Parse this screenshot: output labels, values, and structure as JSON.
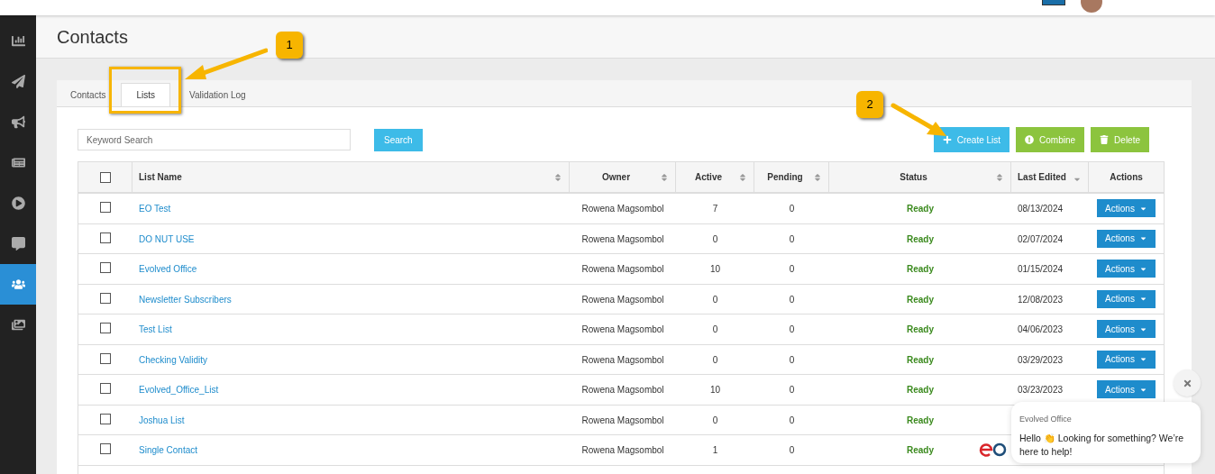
{
  "sidebar": {
    "items": [
      {
        "selected": false
      },
      {
        "selected": false
      },
      {
        "selected": false
      },
      {
        "selected": false
      },
      {
        "selected": false
      },
      {
        "selected": false
      },
      {
        "selected": true
      },
      {
        "selected": false
      }
    ]
  },
  "page_title": "Contacts",
  "tabs": [
    {
      "label": "Contacts",
      "selected": false
    },
    {
      "label": "Lists",
      "selected": true
    },
    {
      "label": "Validation Log",
      "selected": false
    }
  ],
  "search": {
    "placeholder": "Keyword Search",
    "button": "Search"
  },
  "toolbar": [
    {
      "kind": "create",
      "label": "Create List"
    },
    {
      "kind": "combine",
      "label": "Combine"
    },
    {
      "kind": "delete",
      "label": "Delete"
    }
  ],
  "table": {
    "select_all": {
      "checked": false
    },
    "columns": [
      {
        "label": "List Name"
      },
      {
        "label": "Owner"
      },
      {
        "label": "Active"
      },
      {
        "label": "Pending"
      },
      {
        "label": "Status"
      },
      {
        "label": "Last Edited"
      },
      {
        "label": "Actions"
      }
    ],
    "rows": [
      {
        "checked": false,
        "name": "EO Test",
        "owner": "Rowena Magsombol",
        "active": "7",
        "pending": "0",
        "status": "Ready",
        "last_edited": "08/13/2024",
        "action": "Actions"
      },
      {
        "checked": false,
        "name": "DO NUT USE",
        "owner": "Rowena Magsombol",
        "active": "0",
        "pending": "0",
        "status": "Ready",
        "last_edited": "02/07/2024",
        "action": "Actions"
      },
      {
        "checked": false,
        "name": "Evolved Office",
        "owner": "Rowena Magsombol",
        "active": "10",
        "pending": "0",
        "status": "Ready",
        "last_edited": "01/15/2024",
        "action": "Actions"
      },
      {
        "checked": false,
        "name": "Newsletter Subscribers",
        "owner": "Rowena Magsombol",
        "active": "0",
        "pending": "0",
        "status": "Ready",
        "last_edited": "12/08/2023",
        "action": "Actions"
      },
      {
        "checked": false,
        "name": "Test List",
        "owner": "Rowena Magsombol",
        "active": "0",
        "pending": "0",
        "status": "Ready",
        "last_edited": "04/06/2023",
        "action": "Actions"
      },
      {
        "checked": false,
        "name": "Checking Validity",
        "owner": "Rowena Magsombol",
        "active": "0",
        "pending": "0",
        "status": "Ready",
        "last_edited": "03/29/2023",
        "action": "Actions"
      },
      {
        "checked": false,
        "name": "Evolved_Office_List",
        "owner": "Rowena Magsombol",
        "active": "10",
        "pending": "0",
        "status": "Ready",
        "last_edited": "03/23/2023",
        "action": "Actions"
      },
      {
        "checked": false,
        "name": "Joshua List",
        "owner": "Rowena Magsombol",
        "active": "0",
        "pending": "0",
        "status": "Ready"
      },
      {
        "checked": false,
        "name": "Single Contact",
        "owner": "Rowena Magsombol",
        "active": "1",
        "pending": "0",
        "status": "Ready"
      }
    ]
  },
  "callouts": [
    {
      "label": "1"
    },
    {
      "label": "2"
    }
  ],
  "chat": {
    "sender": "Evolved Office",
    "message": "Hello 👏 Looking for something? We’re here to help!"
  }
}
